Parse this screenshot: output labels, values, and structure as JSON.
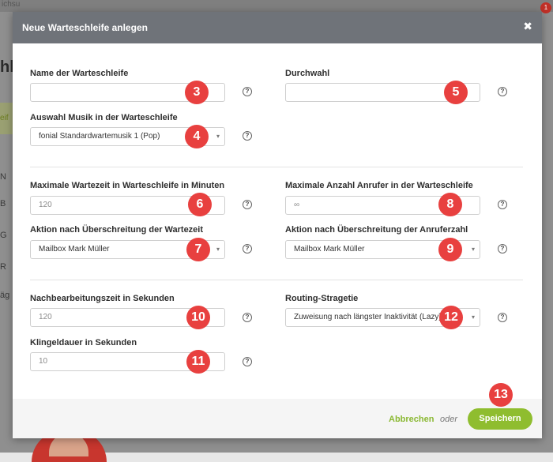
{
  "background": {
    "topbar_text": "ichsu",
    "notification_count": "1",
    "page_heading": "hl",
    "tab_fragment": "eif",
    "column_fragments": [
      "N",
      "B",
      "G",
      "R",
      "äg"
    ]
  },
  "modal": {
    "title": "Neue Warteschleife anlegen",
    "close_symbol": "✖",
    "help_symbol": "?",
    "dropdown_arrow": "▾",
    "fields": {
      "name": {
        "label": "Name der Warteschleife",
        "value": "",
        "badge": "3"
      },
      "durchwahl": {
        "label": "Durchwahl",
        "value": "",
        "badge": "5"
      },
      "musik": {
        "label": "Auswahl Musik in der Warteschleife",
        "value": "fonial Standardwartemusik 1 (Pop)",
        "badge": "4"
      },
      "max_wartezeit": {
        "label": "Maximale Wartezeit in Warteschleife in Minuten",
        "placeholder": "120",
        "badge": "6"
      },
      "max_anrufer": {
        "label": "Maximale Anzahl Anrufer in der Warteschleife",
        "placeholder": "∞",
        "badge": "8"
      },
      "aktion_wartezeit": {
        "label": "Aktion nach Überschreitung der Wartezeit",
        "value": "Mailbox Mark Müller",
        "badge": "7"
      },
      "aktion_anruferzahl": {
        "label": "Aktion nach Überschreitung der Anruferzahl",
        "value": "Mailbox Mark Müller",
        "badge": "9"
      },
      "nachbearbeitung": {
        "label": "Nachbearbeitungszeit in Sekunden",
        "placeholder": "120",
        "badge": "10"
      },
      "routing": {
        "label": "Routing-Stragetie",
        "value": "Zuweisung nach längster Inaktivität (Lazy)",
        "badge": "12"
      },
      "klingeldauer": {
        "label": "Klingeldauer in Sekunden",
        "placeholder": "10",
        "badge": "11"
      }
    },
    "footer": {
      "cancel_label": "Abbrechen",
      "or_label": "oder",
      "save_label": "Speichern",
      "save_badge": "13"
    }
  }
}
